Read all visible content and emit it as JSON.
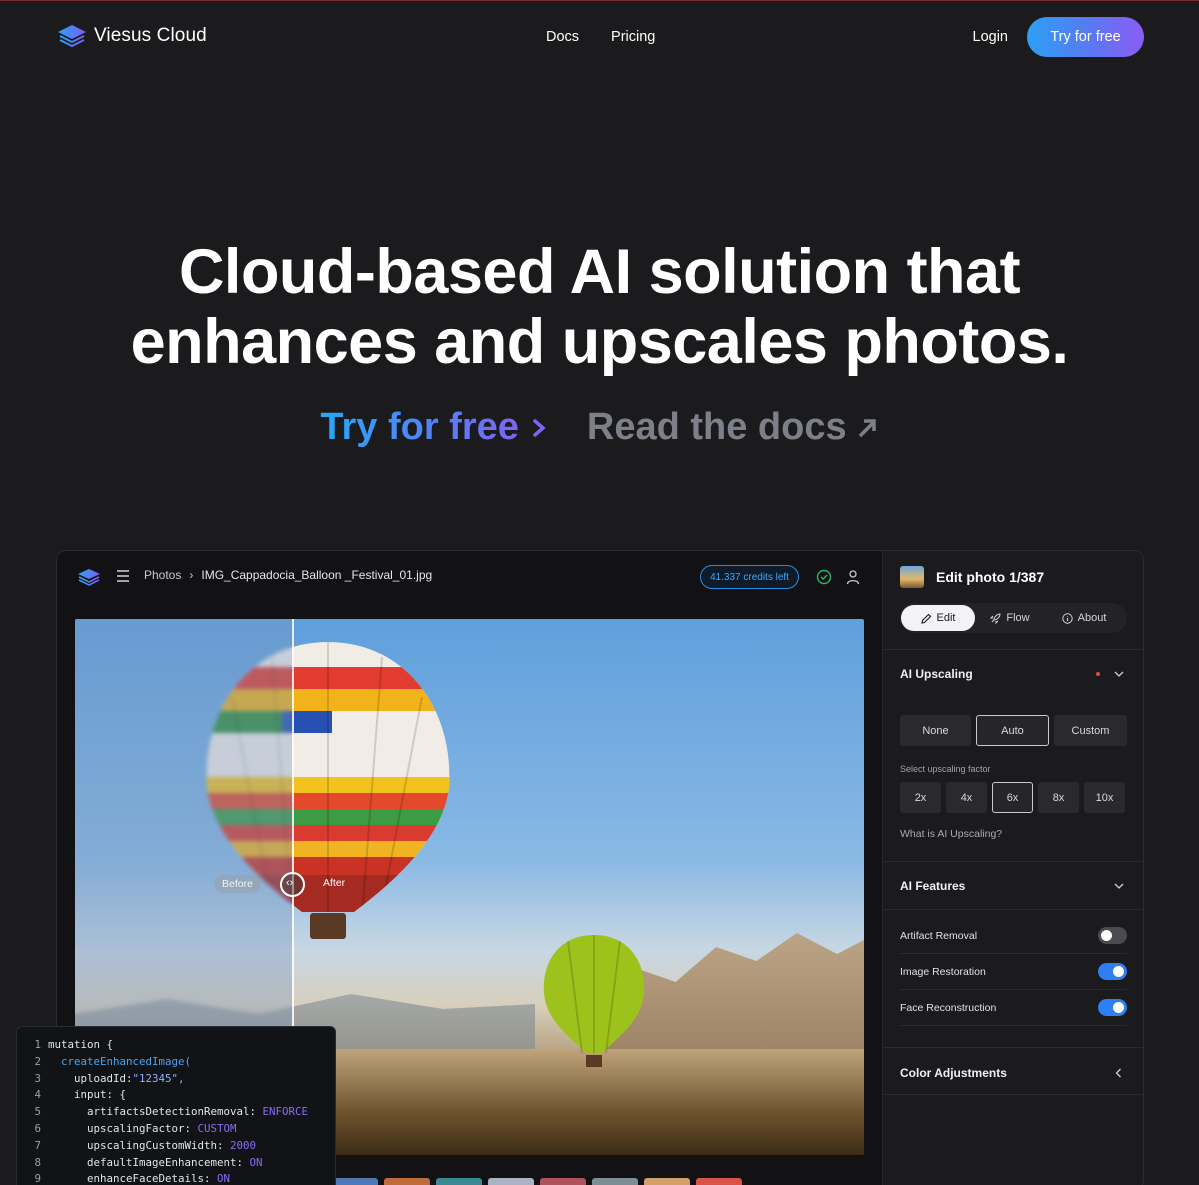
{
  "nav": {
    "brand": "Viesus Cloud",
    "links": [
      "Docs",
      "Pricing"
    ],
    "login": "Login",
    "cta": "Try for free"
  },
  "hero": {
    "title_line1": "Cloud-based AI solution that",
    "title_line2": "enhances and upscales photos.",
    "try_link": "Try for free",
    "docs_link": "Read the docs"
  },
  "app": {
    "breadcrumb_root": "Photos",
    "breadcrumb_file": "IMG_Cappadocia_Balloon _Festival_01.jpg",
    "credits": "41.337 credits left",
    "before_label": "Before",
    "after_label": "After",
    "accent": "#2f7ef2"
  },
  "panel": {
    "title": "Edit photo 1/387",
    "tabs": [
      "Edit",
      "Flow",
      "About"
    ],
    "ai_upscaling": {
      "title": "AI Upscaling",
      "modes": [
        "None",
        "Auto",
        "Custom"
      ],
      "selected_mode": "Auto",
      "factor_label": "Select upscaling factor",
      "factors": [
        "2x",
        "4x",
        "6x",
        "8x",
        "10x"
      ],
      "selected_factor": "6x",
      "help_link": "What is AI Upscaling?"
    },
    "ai_features": {
      "title": "AI Features",
      "items": [
        {
          "label": "Artifact Removal",
          "enabled": false
        },
        {
          "label": "Image Restoration",
          "enabled": true
        },
        {
          "label": "Face Reconstruction",
          "enabled": true
        }
      ]
    },
    "color_adjustments": "Color Adjustments"
  },
  "code": {
    "lines": [
      {
        "n": "1",
        "text": "mutation {"
      },
      {
        "n": "2",
        "text": "createEnhancedImage("
      },
      {
        "n": "3",
        "key": "uploadId:",
        "value": "\"12345\","
      },
      {
        "n": "4",
        "text": "input: {"
      },
      {
        "n": "5",
        "key": "artifactsDetectionRemoval: ",
        "value": "ENFORCE"
      },
      {
        "n": "6",
        "key": "upscalingFactor: ",
        "value": "CUSTOM"
      },
      {
        "n": "7",
        "key": "upscalingCustomWidth: ",
        "value": "2000"
      },
      {
        "n": "8",
        "key": "defaultImageEnhancement: ",
        "value": "ON"
      },
      {
        "n": "9",
        "key": "enhanceFaceDetails: ",
        "value": "ON"
      }
    ]
  }
}
